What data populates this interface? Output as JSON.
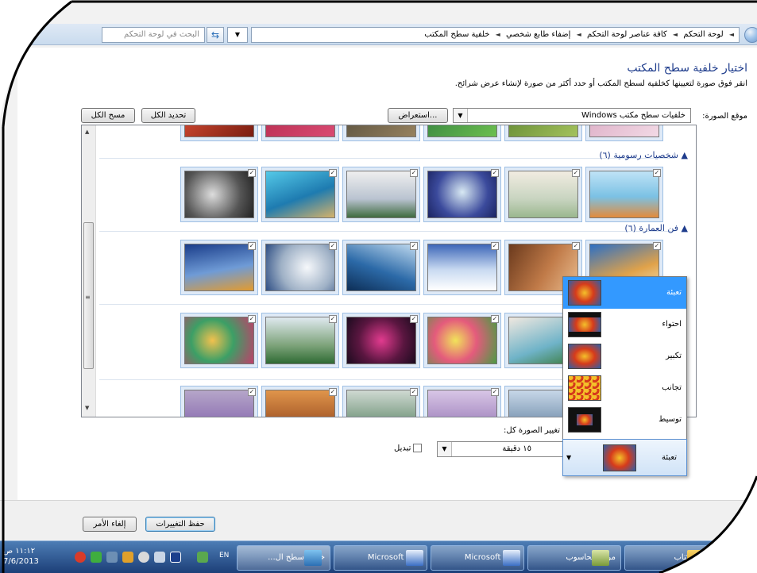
{
  "address": {
    "crumbs": [
      "لوحة التحكم",
      "كافة عناصر لوحة التحكم",
      "إضفاء طابع شخصي",
      "خلفية سطح المكتب"
    ],
    "search_placeholder": "البحث في لوحة التحكم"
  },
  "page": {
    "title": "اختيار خلفية سطح المكتب",
    "subtitle": "انقر فوق صورة لتعيينها كخلفية لسطح المكتب أو حدد أكثر من صورة لإنشاء عرض شرائح.",
    "location_label": "موقع الصورة:",
    "location_value": "خلفيات سطح مكتب Windows",
    "browse_label": "استعراض...",
    "select_all_label": "تحديد الكل",
    "clear_all_label": "مسح الكل"
  },
  "groups": {
    "characters_title": "شخصيات رسومية (٦)",
    "architecture_title": "فن العمارة (٦)"
  },
  "slideshow": {
    "change_label": "تغيير الصورة كل:",
    "interval_value": "١٥ دقيقة",
    "shuffle_label": "تبديل"
  },
  "position": {
    "options": [
      "تعبئة",
      "احتواء",
      "تكبير",
      "تجانب",
      "توسيط"
    ],
    "selected": "تعبئة"
  },
  "footer": {
    "save_label": "حفظ التغييرات",
    "cancel_label": "إلغاء الأمر"
  },
  "taskbar": {
    "items": [
      "صور الكتاب",
      "مركز الحاسوب",
      "...Microsoft W",
      "...Microsoft W",
      "خلفية سطح ال..."
    ],
    "lang": "EN",
    "time": "١١:١٢ ص",
    "date": "7/6/2013"
  }
}
